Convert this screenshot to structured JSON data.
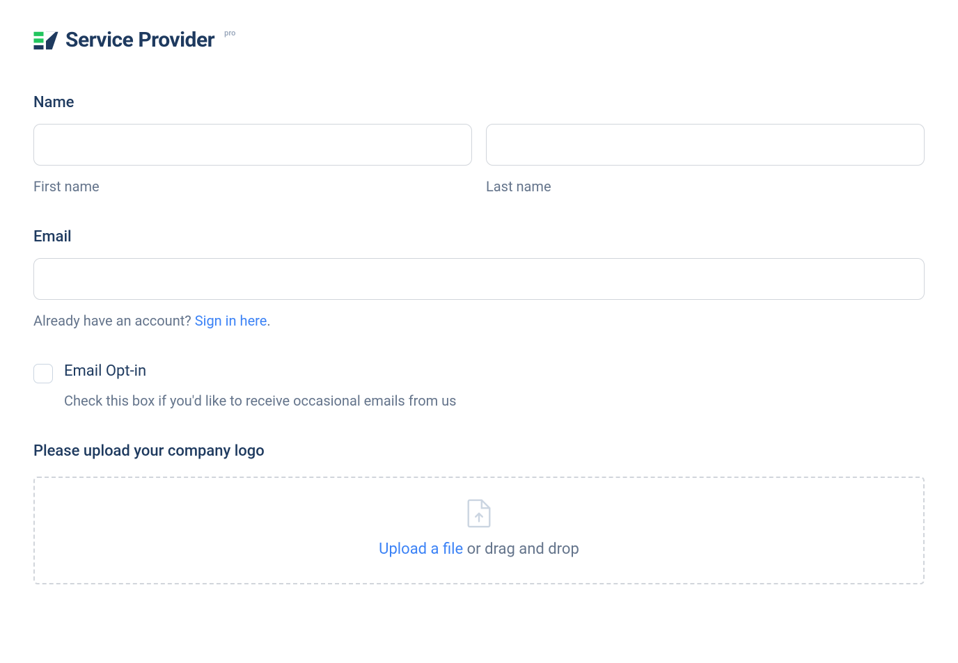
{
  "logo": {
    "text": "Service Provider",
    "badge": "pro"
  },
  "name_section": {
    "label": "Name",
    "first_name_sublabel": "First name",
    "last_name_sublabel": "Last name",
    "first_name_value": "",
    "last_name_value": ""
  },
  "email_section": {
    "label": "Email",
    "value": "",
    "helper_prefix": "Already have an account? ",
    "helper_link": "Sign in here",
    "helper_suffix": "."
  },
  "optin_section": {
    "label": "Email Opt-in",
    "description": "Check this box if you'd like to receive occasional emails from us"
  },
  "upload_section": {
    "label": "Please upload your company logo",
    "link_text": "Upload a file",
    "rest_text": " or drag and drop"
  }
}
